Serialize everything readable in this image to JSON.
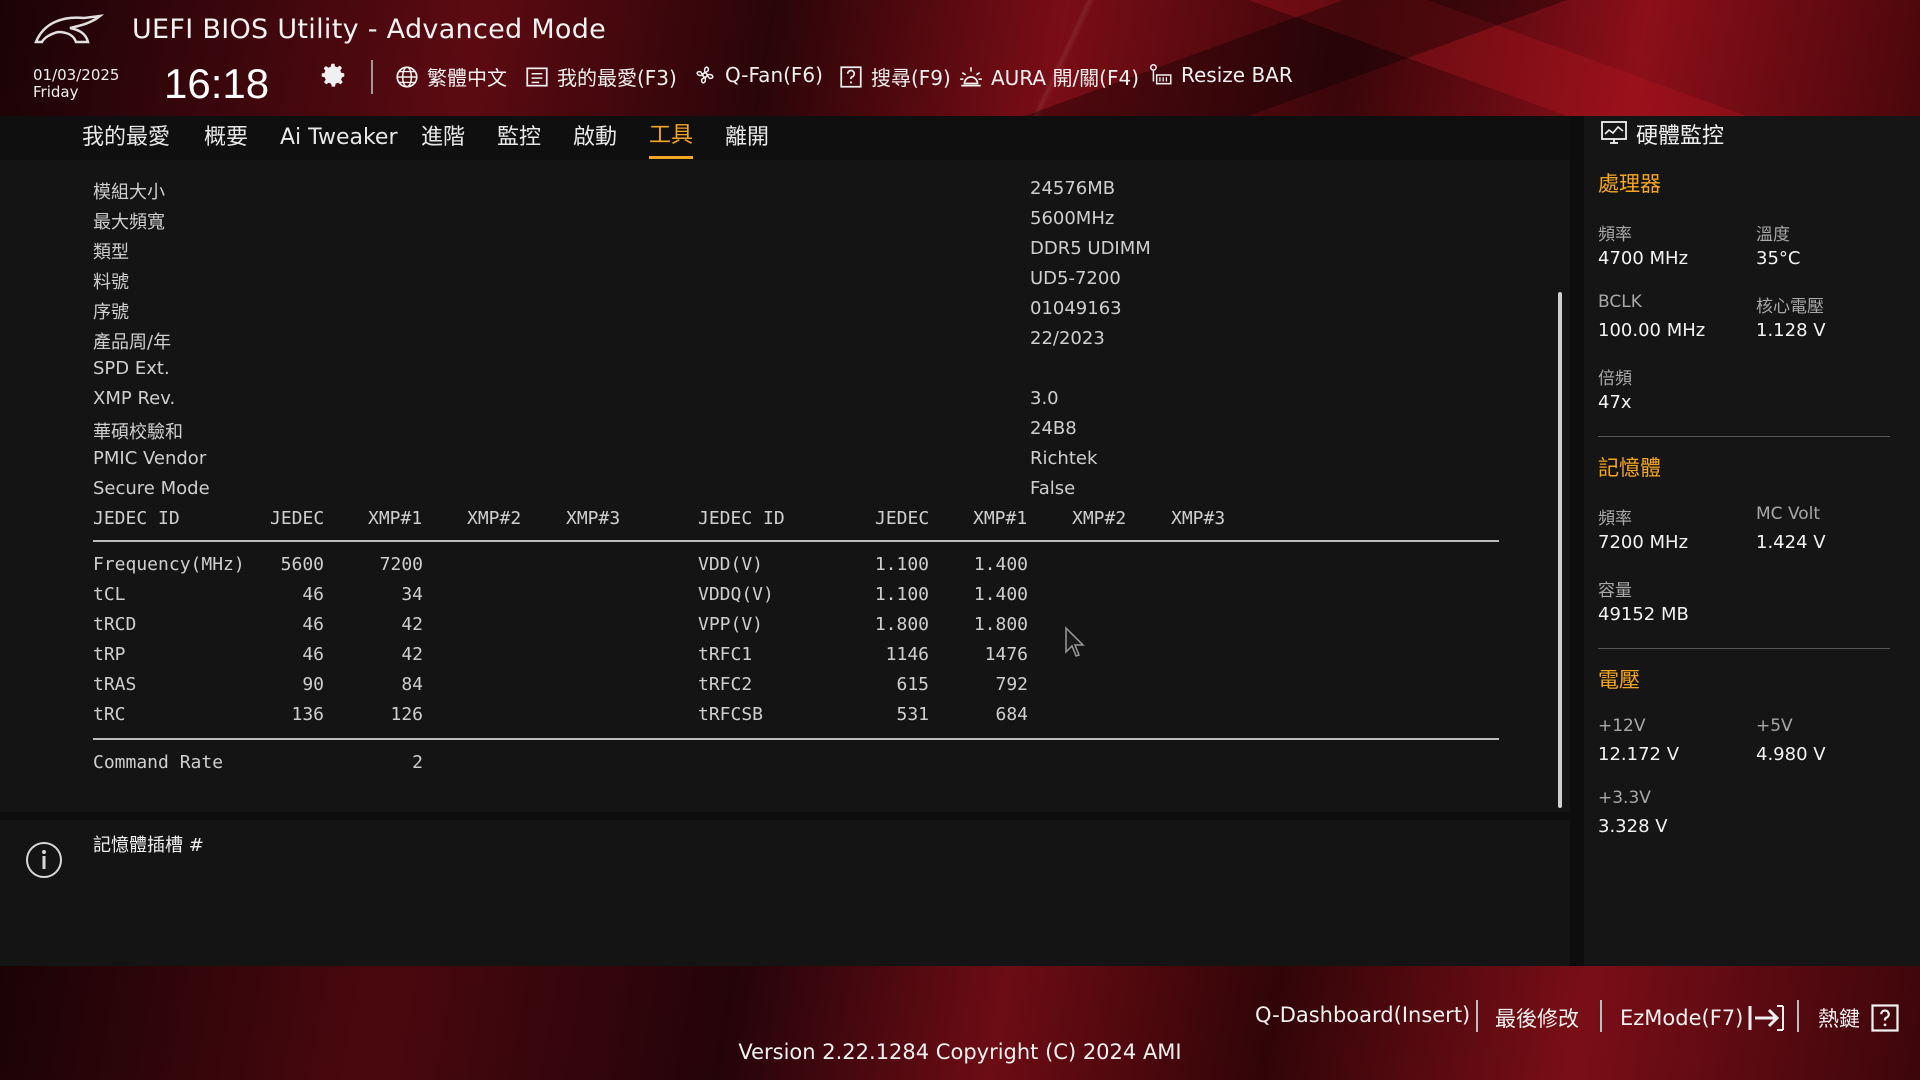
{
  "header": {
    "title": "UEFI BIOS Utility - Advanced Mode",
    "date": "01/03/2025",
    "weekday": "Friday",
    "time": "16:18",
    "toolbar": [
      {
        "label": "繁體中文",
        "icon": "globe-icon"
      },
      {
        "label": "我的最愛(F3)",
        "icon": "favorites-list-icon"
      },
      {
        "label": "Q-Fan(F6)",
        "icon": "fan-icon"
      },
      {
        "label": "搜尋(F9)",
        "icon": "question-box-icon"
      },
      {
        "label": "AURA 開/關(F4)",
        "icon": "aura-light-icon"
      },
      {
        "label": "Resize BAR",
        "icon": "resize-bar-icon"
      }
    ]
  },
  "menu": {
    "items": [
      "我的最愛",
      "概要",
      "Ai Tweaker",
      "進階",
      "監控",
      "啟動",
      "工具",
      "離開"
    ],
    "active": "工具"
  },
  "spd_info": [
    {
      "label": "模組大小",
      "value": "24576MB"
    },
    {
      "label": "最大頻寬",
      "value": "5600MHz"
    },
    {
      "label": "類型",
      "value": "DDR5 UDIMM"
    },
    {
      "label": "料號",
      "value": "UD5-7200"
    },
    {
      "label": "序號",
      "value": "01049163"
    },
    {
      "label": "產品周/年",
      "value": "22/2023"
    },
    {
      "label": "SPD Ext.",
      "value": ""
    },
    {
      "label": "XMP Rev.",
      "value": "3.0"
    },
    {
      "label": "華碩校驗和",
      "value": "24B8"
    },
    {
      "label": "PMIC Vendor",
      "value": "Richtek"
    },
    {
      "label": "Secure Mode",
      "value": "False"
    }
  ],
  "timing_table": {
    "headers_left": [
      "JEDEC ID",
      "JEDEC",
      "XMP#1",
      "XMP#2",
      "XMP#3"
    ],
    "headers_right": [
      "JEDEC ID",
      "JEDEC",
      "XMP#1",
      "XMP#2",
      "XMP#3"
    ],
    "rows": [
      {
        "l_name": "Frequency(MHz)",
        "l_jedec": "5600",
        "l_xmp1": "7200",
        "r_name": "VDD(V)",
        "r_jedec": "1.100",
        "r_xmp1": "1.400"
      },
      {
        "l_name": "tCL",
        "l_jedec": "46",
        "l_xmp1": "34",
        "r_name": "VDDQ(V)",
        "r_jedec": "1.100",
        "r_xmp1": "1.400"
      },
      {
        "l_name": "tRCD",
        "l_jedec": "46",
        "l_xmp1": "42",
        "r_name": "VPP(V)",
        "r_jedec": "1.800",
        "r_xmp1": "1.800"
      },
      {
        "l_name": "tRP",
        "l_jedec": "46",
        "l_xmp1": "42",
        "r_name": "tRFC1",
        "r_jedec": "1146",
        "r_xmp1": "1476"
      },
      {
        "l_name": "tRAS",
        "l_jedec": "90",
        "l_xmp1": "84",
        "r_name": "tRFC2",
        "r_jedec": "615",
        "r_xmp1": "792"
      },
      {
        "l_name": "tRC",
        "l_jedec": "136",
        "l_xmp1": "126",
        "r_name": "tRFCSB",
        "r_jedec": "531",
        "r_xmp1": "684"
      }
    ],
    "command_rate": {
      "label": "Command Rate",
      "value": "2"
    }
  },
  "info": {
    "text": "記憶體插槽 #"
  },
  "hw_monitor": {
    "title": "硬體監控",
    "cpu": {
      "title": "處理器",
      "freq_label": "頻率",
      "freq": "4700 MHz",
      "temp_label": "溫度",
      "temp": "35°C",
      "bclk_label": "BCLK",
      "bclk": "100.00 MHz",
      "vcore_label": "核心電壓",
      "vcore": "1.128 V",
      "ratio_label": "倍頻",
      "ratio": "47x"
    },
    "memory": {
      "title": "記憶體",
      "freq_label": "頻率",
      "freq": "7200 MHz",
      "mcvolt_label": "MC Volt",
      "mcvolt": "1.424 V",
      "cap_label": "容量",
      "cap": "49152 MB"
    },
    "voltage": {
      "title": "電壓",
      "v12_label": "+12V",
      "v12": "12.172 V",
      "v5_label": "+5V",
      "v5": "4.980 V",
      "v33_label": "+3.3V",
      "v33": "3.328 V"
    }
  },
  "bottom": {
    "qdashboard": "Q-Dashboard(Insert)",
    "last_modified": "最後修改",
    "ezmode": "EzMode(F7)",
    "hotkeys": "熱鍵",
    "version": "Version 2.22.1284 Copyright (C) 2024 AMI"
  },
  "colors": {
    "accent": "#f5a623",
    "brand_red": "#8c0f19"
  }
}
